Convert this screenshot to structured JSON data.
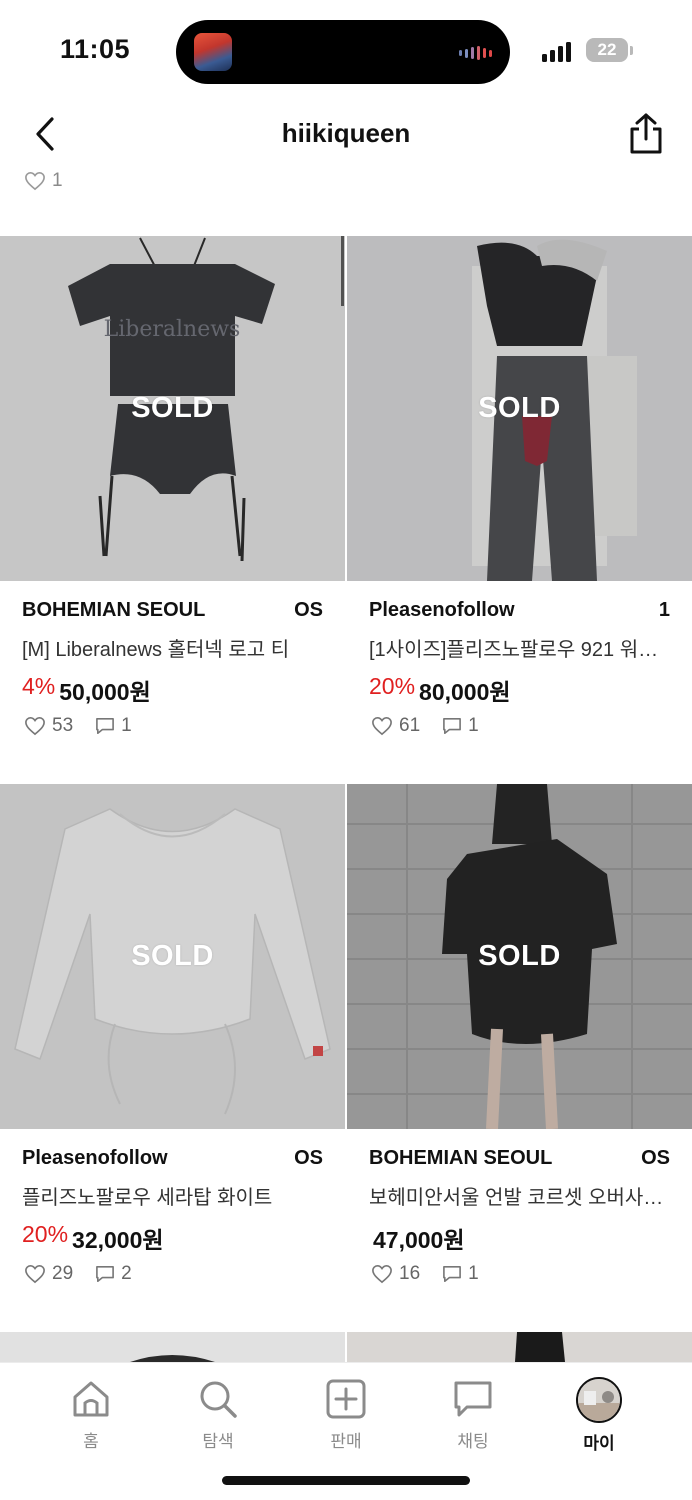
{
  "status": {
    "time": "11:05",
    "battery": "22"
  },
  "header": {
    "title": "hiikiqueen"
  },
  "top_like_count": "1",
  "products": [
    {
      "brand": "BOHEMIAN SEOUL",
      "size": "OS",
      "title": "[M] Liberalnews 홀터넥 로고 티",
      "discount": "4%",
      "price": "50,000원",
      "likes": "53",
      "comments": "1",
      "sold_label": "SOLD"
    },
    {
      "brand": "Pleasenofollow",
      "size": "1",
      "title": "[1사이즈]플리즈노팔로우 921 워싱…",
      "discount": "20%",
      "price": "80,000원",
      "likes": "61",
      "comments": "1",
      "sold_label": "SOLD"
    },
    {
      "brand": "Pleasenofollow",
      "size": "OS",
      "title": "플리즈노팔로우 세라탑 화이트",
      "discount": "20%",
      "price": "32,000원",
      "likes": "29",
      "comments": "2",
      "sold_label": "SOLD"
    },
    {
      "brand": "BOHEMIAN SEOUL",
      "size": "OS",
      "title": "보헤미안서울 언발 코르셋 오버사…",
      "discount": "",
      "price": "47,000원",
      "likes": "16",
      "comments": "1",
      "sold_label": "SOLD"
    }
  ],
  "tabbar": {
    "home": "홈",
    "explore": "탐색",
    "sell": "판매",
    "chat": "채팅",
    "my": "마이"
  },
  "colors": {
    "discount": "#e02020",
    "text": "#111111",
    "muted": "#8a8a8a"
  }
}
